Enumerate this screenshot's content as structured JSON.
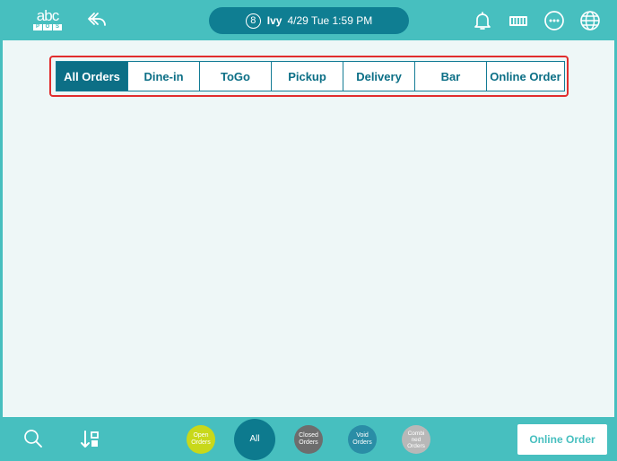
{
  "header": {
    "logo": {
      "top": "abc",
      "bottom": [
        "P",
        "O",
        "S"
      ]
    },
    "seat_number": "8",
    "user_name": "Ivy",
    "datetime": "4/29 Tue 1:59 PM",
    "icons": [
      "bell-icon",
      "cash-register-icon",
      "more-options-icon",
      "globe-icon"
    ]
  },
  "tabs": [
    {
      "label": "All Orders",
      "active": true
    },
    {
      "label": "Dine-in",
      "active": false
    },
    {
      "label": "ToGo",
      "active": false
    },
    {
      "label": "Pickup",
      "active": false
    },
    {
      "label": "Delivery",
      "active": false
    },
    {
      "label": "Bar",
      "active": false
    },
    {
      "label": "Online Order",
      "active": false
    }
  ],
  "footer": {
    "filters": [
      {
        "label_lines": [
          "Open",
          "Orders"
        ],
        "color": "#c8d81a"
      },
      {
        "label_lines": [
          "All"
        ],
        "color": "#0d7a8e"
      },
      {
        "label_lines": [
          "Closed",
          "Orders"
        ],
        "color": "#6d6d6d"
      },
      {
        "label_lines": [
          "Void",
          "Orders"
        ],
        "color": "#2a8da6"
      },
      {
        "label_lines": [
          "Combi",
          "ned",
          "Orders"
        ],
        "color": "#b8b8b8"
      }
    ],
    "online_order_label": "Online Order"
  },
  "colors": {
    "bar": "#47bfbf",
    "accent": "#0c6f86",
    "highlight_border": "#e12d2d"
  }
}
